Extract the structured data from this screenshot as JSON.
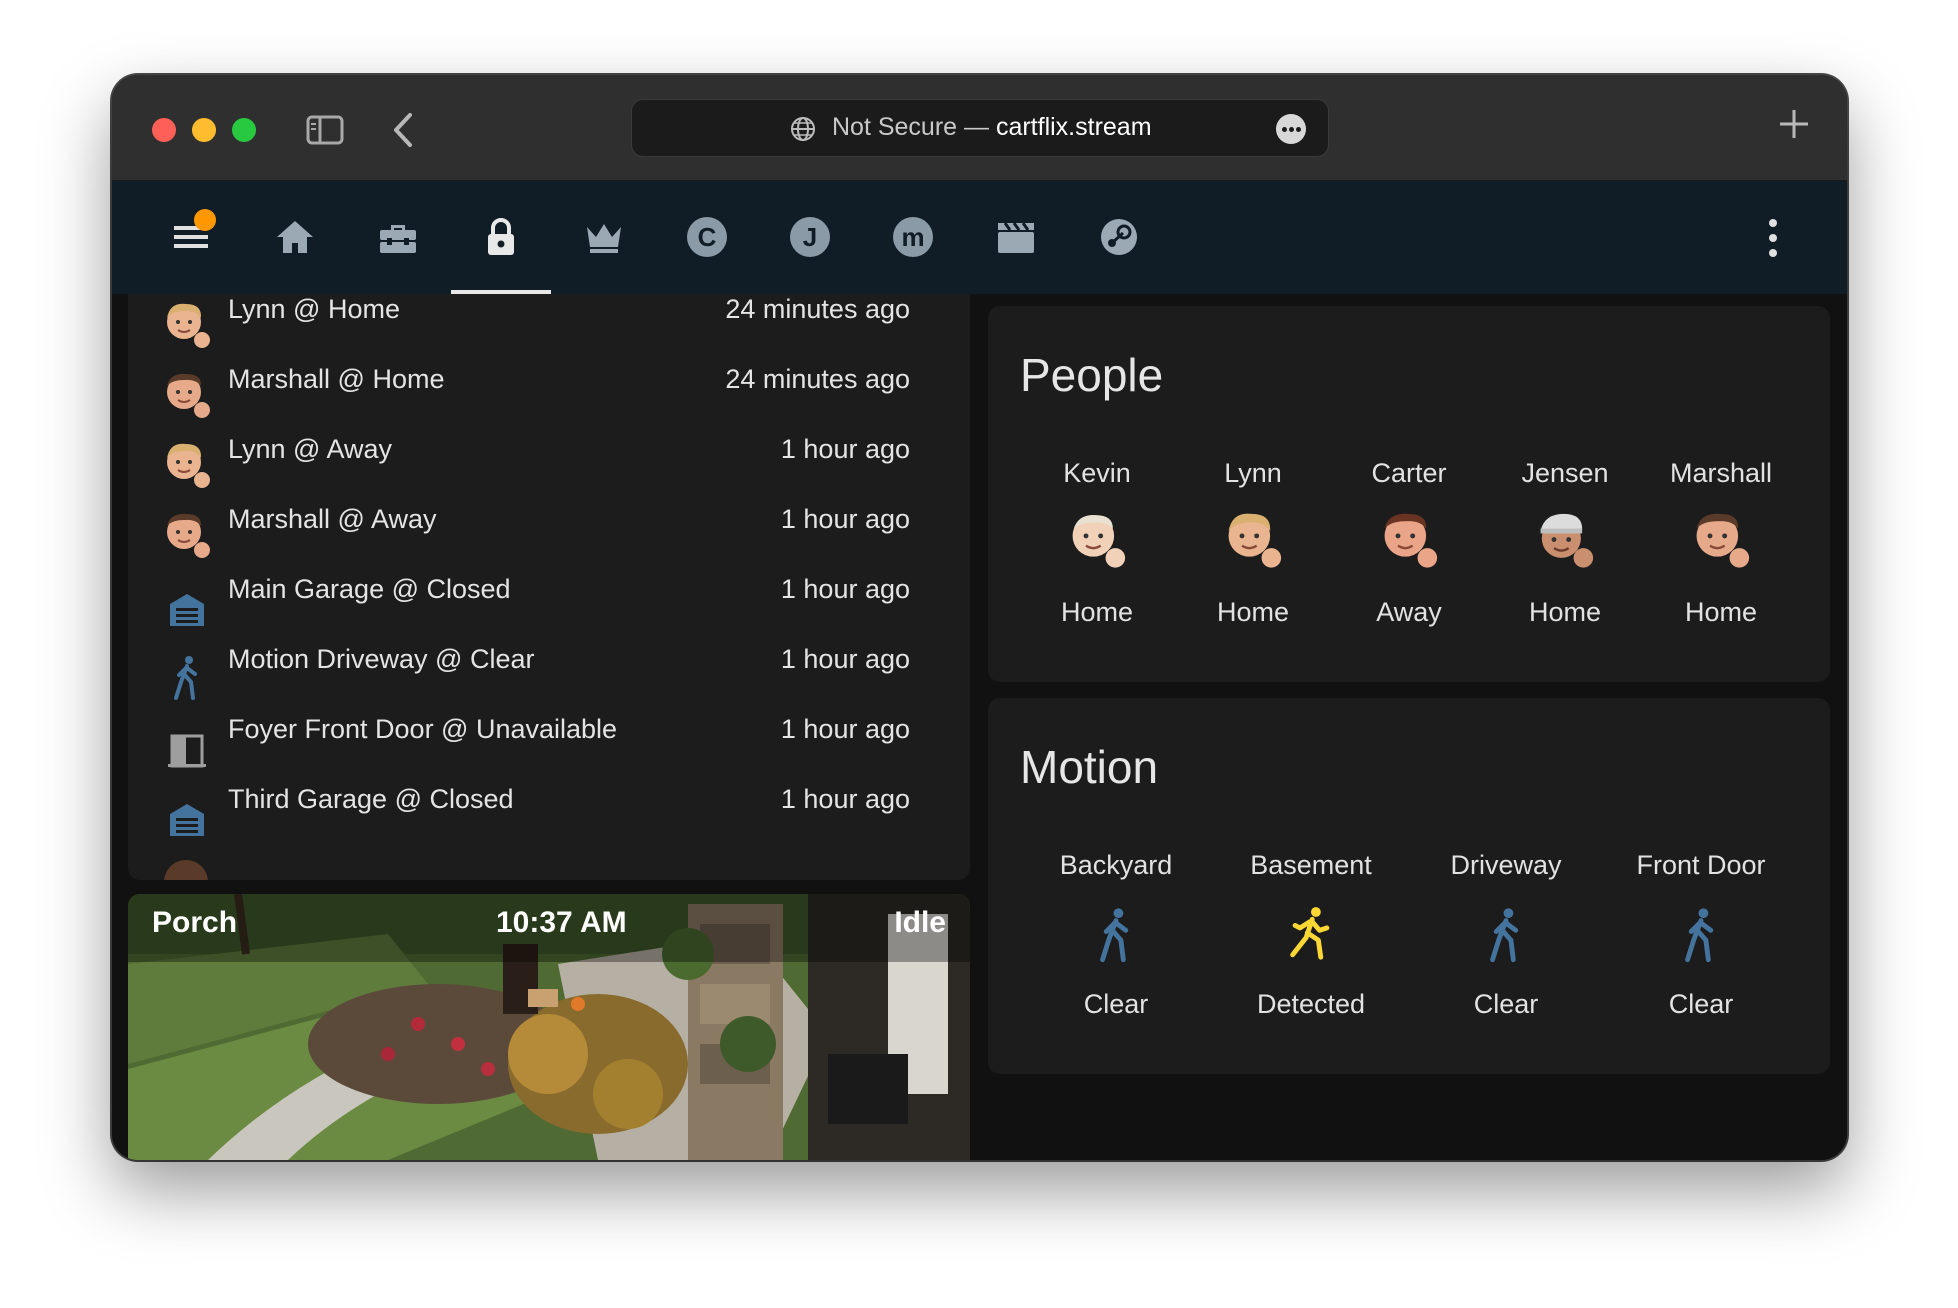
{
  "browser": {
    "url_prefix": "Not Secure — ",
    "url_host": "cartflix.stream"
  },
  "toolbar": {
    "icons": [
      "menu-icon",
      "home-icon",
      "toolbox-icon",
      "lock-icon",
      "crown-icon",
      "c-circle-icon",
      "j-circle-icon",
      "m-circle-icon",
      "clapperboard-icon",
      "steam-icon"
    ],
    "letters": {
      "c": "C",
      "j": "J",
      "m": "m"
    },
    "active": "lock-icon"
  },
  "logbook": {
    "entries": [
      {
        "name": "Lynn @ Home",
        "time": "24 minutes ago",
        "icon": "person-avatar-icon"
      },
      {
        "name": "Marshall @ Home",
        "time": "24 minutes ago",
        "icon": "person-avatar-icon"
      },
      {
        "name": "Lynn @ Away",
        "time": "1 hour ago",
        "icon": "person-avatar-icon"
      },
      {
        "name": "Marshall @ Away",
        "time": "1 hour ago",
        "icon": "person-avatar-icon"
      },
      {
        "name": "Main Garage @ Closed",
        "time": "1 hour ago",
        "icon": "garage-icon"
      },
      {
        "name": "Motion Driveway @ Clear",
        "time": "1 hour ago",
        "icon": "walk-icon"
      },
      {
        "name": "Foyer Front Door @ Unavailable",
        "time": "1 hour ago",
        "icon": "door-icon"
      },
      {
        "name": "Third Garage @ Closed",
        "time": "1 hour ago",
        "icon": "garage-icon"
      }
    ]
  },
  "camera": {
    "name": "Porch",
    "time": "10:37 AM",
    "status": "Idle"
  },
  "people": {
    "title": "People",
    "items": [
      {
        "name": "Kevin",
        "state": "Home"
      },
      {
        "name": "Lynn",
        "state": "Home"
      },
      {
        "name": "Carter",
        "state": "Away"
      },
      {
        "name": "Jensen",
        "state": "Home"
      },
      {
        "name": "Marshall",
        "state": "Home"
      }
    ]
  },
  "motion": {
    "title": "Motion",
    "items": [
      {
        "name": "Backyard",
        "state": "Clear",
        "color": "#44739e"
      },
      {
        "name": "Basement",
        "state": "Detected",
        "color": "#fdd835"
      },
      {
        "name": "Driveway",
        "state": "Clear",
        "color": "#44739e"
      },
      {
        "name": "Front Door",
        "state": "Clear",
        "color": "#44739e"
      }
    ]
  },
  "colors": {
    "accent_badge": "#ff9800",
    "icon_blue": "#44739e",
    "icon_yellow": "#fdd835"
  }
}
